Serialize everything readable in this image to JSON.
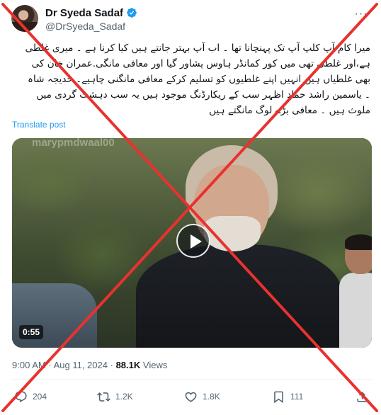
{
  "author": {
    "name": "Dr Syeda Sadaf",
    "handle": "@DrSyeda_Sadaf",
    "verified": true
  },
  "tweet": {
    "lines": [
      "میرا کام آپ کلپ آپ تک پہنچانا تھا ۔ اب آپ بہتر جانتے ہیں کیا کرنا ہے ۔ میری غلطی",
      "ہے،اور غلطی تھی میں کور کمانڈر ہاوس پشاور گیا اور  معافی مانگی.عمران خان کی",
      "بھی غلطیاں ہیں انہیں اپنے غلطیوں کو تسلیم کرکے معافی مانگنی چاہیے۔ خدیجہ شاہ",
      "۔ یاسمین راشد حماد اظہر سب کے ریکارڈنگ موجود ہیں یہ سب دہشت گردی میں",
      "ملوث ہیں ۔ معافی بڑے لوگ مانگتے ہیں"
    ],
    "translate_label": "Translate post"
  },
  "media": {
    "duration": "0:55",
    "watermark": "marypmdwaal00"
  },
  "meta": {
    "time": "9:00 AM",
    "separator": "·",
    "date": "Aug 11, 2024",
    "views_count": "88.1K",
    "views_label": "Views"
  },
  "actions": {
    "replies": "204",
    "reposts": "1.2K",
    "likes": "1.8K",
    "bookmarks": "111"
  },
  "colors": {
    "accent": "#1d9bf0",
    "cross": "#e8322e",
    "muted": "#536471"
  },
  "icons": [
    "verified-badge-icon",
    "more-icon",
    "play-icon",
    "reply-icon",
    "repost-icon",
    "like-icon",
    "bookmark-icon",
    "share-icon"
  ]
}
